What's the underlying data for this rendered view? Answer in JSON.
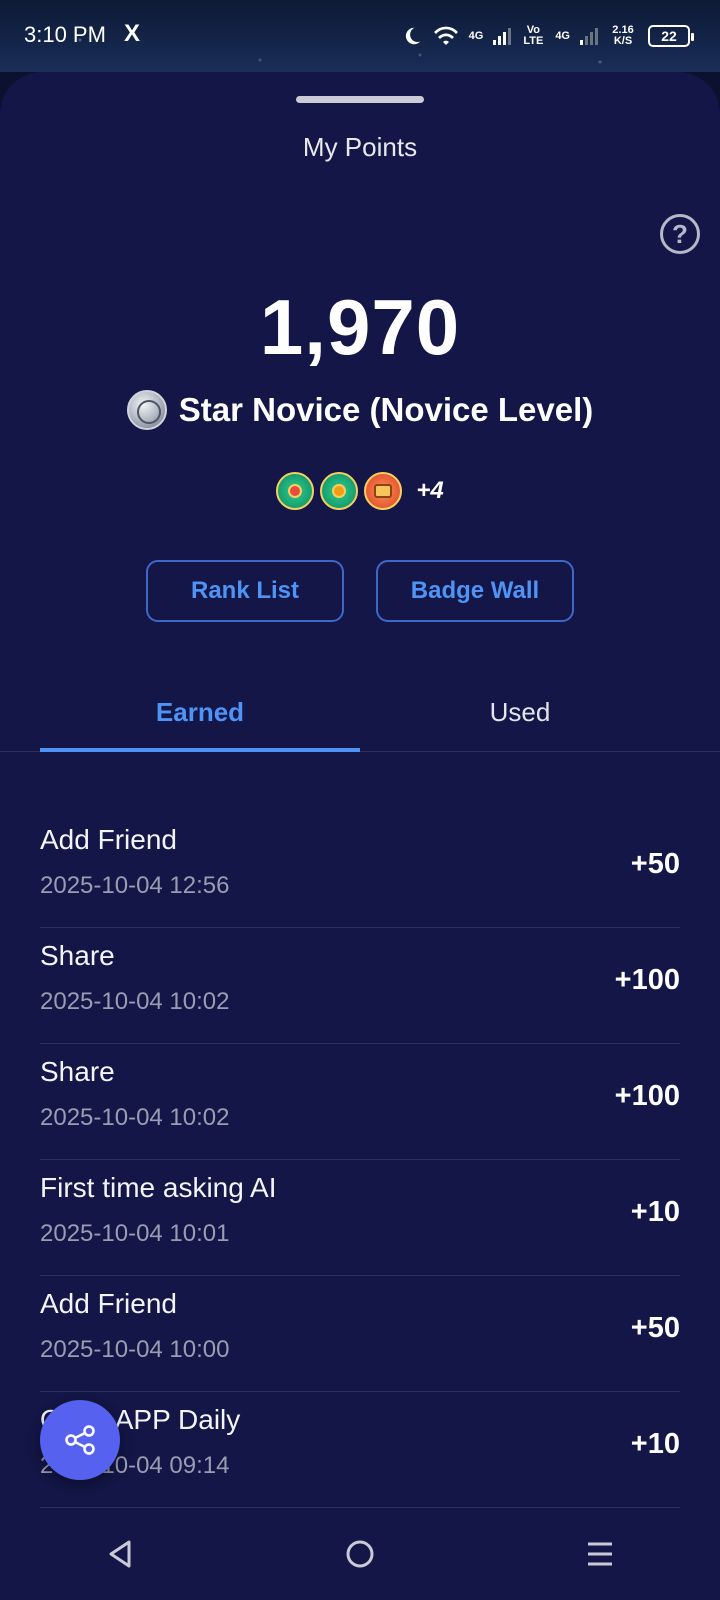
{
  "status_bar": {
    "time": "3:10 PM",
    "x_icon": "X",
    "net1": "4G",
    "volte": "Vo LTE",
    "net2": "4G",
    "speed": "2.16 K/S",
    "battery": "22"
  },
  "sheet": {
    "title": "My Points",
    "points": "1,970",
    "level": "Star Novice (Novice Level)",
    "badges_more": "+4",
    "buttons": {
      "rank": "Rank List",
      "badge": "Badge Wall"
    },
    "tabs": {
      "earned": "Earned",
      "used": "Used"
    }
  },
  "records": [
    {
      "title": "Add Friend",
      "date": "2025-10-04 12:56",
      "points": "+50"
    },
    {
      "title": "Share",
      "date": "2025-10-04 10:02",
      "points": "+100"
    },
    {
      "title": "Share",
      "date": "2025-10-04 10:02",
      "points": "+100"
    },
    {
      "title": "First time asking AI",
      "date": "2025-10-04 10:01",
      "points": "+10"
    },
    {
      "title": "Add Friend",
      "date": "2025-10-04 10:00",
      "points": "+50"
    },
    {
      "title": "Open APP Daily",
      "date": "2025-10-04 09:14",
      "points": "+10"
    }
  ],
  "icons": {
    "help": "question-circle-icon",
    "share_fab": "share-nodes-icon",
    "nav_back": "triangle-back-icon",
    "nav_home": "circle-home-icon",
    "nav_menu": "hamburger-menu-icon"
  },
  "colors": {
    "accent": "#4f93f5",
    "sheet_bg": "#131646",
    "fab": "#5661f0"
  }
}
